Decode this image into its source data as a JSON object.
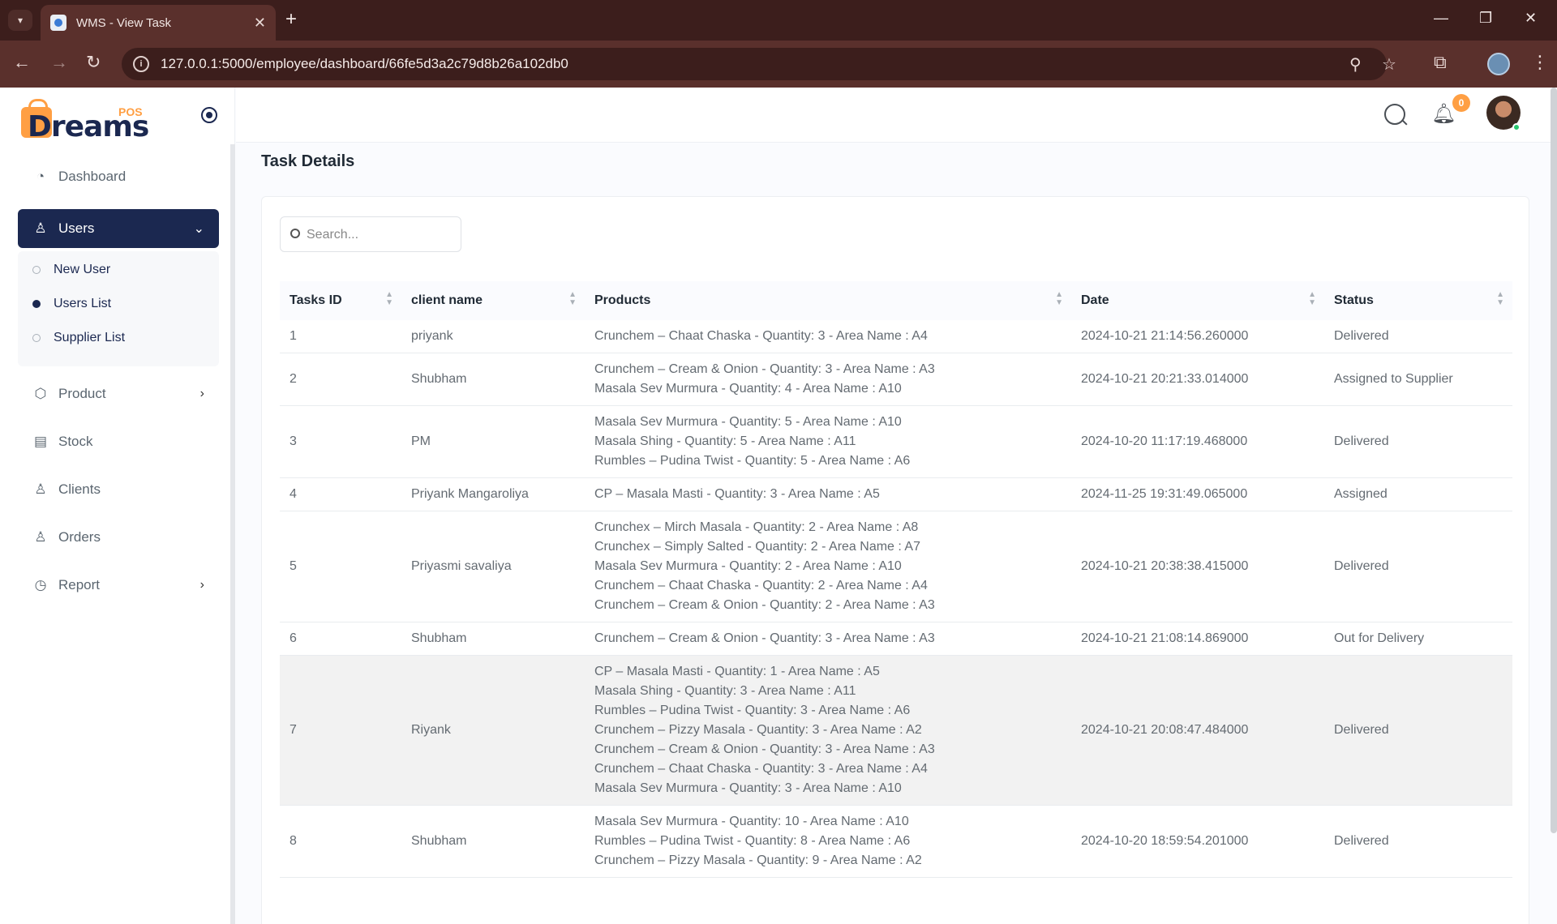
{
  "browser": {
    "tab_title": "WMS - View Task",
    "url": "127.0.0.1:5000/employee/dashboard/66fe5d3a2c79d8b26a102db0"
  },
  "logo": {
    "word": "Dreams",
    "badge": "POS"
  },
  "sidebar": {
    "items": [
      {
        "label": "Dashboard",
        "icon": "dashboard-icon"
      },
      {
        "label": "Users",
        "icon": "user-icon"
      },
      {
        "label": "Product",
        "icon": "box-icon"
      },
      {
        "label": "Stock",
        "icon": "stock-icon"
      },
      {
        "label": "Clients",
        "icon": "user-icon"
      },
      {
        "label": "Orders",
        "icon": "user-icon"
      },
      {
        "label": "Report",
        "icon": "clock-icon"
      }
    ],
    "submenu": [
      "New User",
      "Users List",
      "Supplier List"
    ]
  },
  "header": {
    "notification_count": "0"
  },
  "page": {
    "title": "Task Details"
  },
  "search": {
    "placeholder": "Search..."
  },
  "table": {
    "columns": [
      "Tasks ID",
      "client name",
      "Products",
      "Date",
      "Status"
    ],
    "rows": [
      {
        "id": "1",
        "client": "priyank",
        "products": [
          "Crunchem – Chaat Chaska - Quantity: 3 - Area Name : A4"
        ],
        "date": "2024-10-21 21:14:56.260000",
        "status": "Delivered"
      },
      {
        "id": "2",
        "client": "Shubham",
        "products": [
          "Crunchem – Cream & Onion - Quantity: 3 - Area Name : A3",
          "Masala Sev Murmura - Quantity: 4 - Area Name : A10"
        ],
        "date": "2024-10-21 20:21:33.014000",
        "status": "Assigned to Supplier"
      },
      {
        "id": "3",
        "client": "PM",
        "products": [
          "Masala Sev Murmura - Quantity: 5 - Area Name : A10",
          "Masala Shing - Quantity: 5 - Area Name : A11",
          "Rumbles – Pudina Twist - Quantity: 5 - Area Name : A6"
        ],
        "date": "2024-10-20 11:17:19.468000",
        "status": "Delivered"
      },
      {
        "id": "4",
        "client": "Priyank Mangaroliya",
        "products": [
          "CP – Masala Masti - Quantity: 3 - Area Name : A5"
        ],
        "date": "2024-11-25 19:31:49.065000",
        "status": "Assigned"
      },
      {
        "id": "5",
        "client": "Priyasmi savaliya",
        "products": [
          "Crunchex – Mirch Masala - Quantity: 2 - Area Name : A8",
          "Crunchex – Simply Salted - Quantity: 2 - Area Name : A7",
          "Masala Sev Murmura - Quantity: 2 - Area Name : A10",
          "Crunchem – Chaat Chaska - Quantity: 2 - Area Name : A4",
          "Crunchem – Cream & Onion - Quantity: 2 - Area Name : A3"
        ],
        "date": "2024-10-21 20:38:38.415000",
        "status": "Delivered"
      },
      {
        "id": "6",
        "client": "Shubham",
        "products": [
          "Crunchem – Cream & Onion - Quantity: 3 - Area Name : A3"
        ],
        "date": "2024-10-21 21:08:14.869000",
        "status": "Out for Delivery"
      },
      {
        "id": "7",
        "client": "Riyank",
        "products": [
          "CP – Masala Masti - Quantity: 1 - Area Name : A5",
          "Masala Shing - Quantity: 3 - Area Name : A11",
          "Rumbles – Pudina Twist - Quantity: 3 - Area Name : A6",
          "Crunchem – Pizzy Masala - Quantity: 3 - Area Name : A2",
          "Crunchem – Cream & Onion - Quantity: 3 - Area Name : A3",
          "Crunchem – Chaat Chaska - Quantity: 3 - Area Name : A4",
          "Masala Sev Murmura - Quantity: 3 - Area Name : A10"
        ],
        "date": "2024-10-21 20:08:47.484000",
        "status": "Delivered",
        "highlighted": true
      },
      {
        "id": "8",
        "client": "Shubham",
        "products": [
          "Masala Sev Murmura - Quantity: 10 - Area Name : A10",
          "Rumbles – Pudina Twist - Quantity: 8 - Area Name : A6",
          "Crunchem – Pizzy Masala - Quantity: 9 - Area Name : A2"
        ],
        "date": "2024-10-20 18:59:54.201000",
        "status": "Delivered"
      }
    ]
  },
  "colors": {
    "primary": "#1b2850",
    "accent": "#ff9f43",
    "online": "#28c76f"
  }
}
